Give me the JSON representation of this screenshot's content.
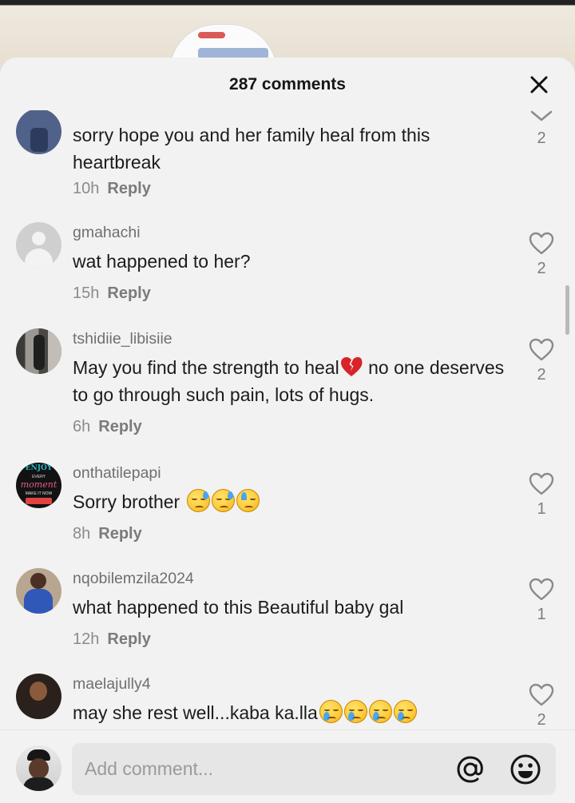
{
  "header": {
    "title": "287 comments"
  },
  "comments": [
    {
      "username": "",
      "text": "sorry hope you and her family heal from this heartbreak",
      "time": "10h",
      "reply": "Reply",
      "likes": "2",
      "icon": "chevron-down-icon"
    },
    {
      "username": "gmahachi",
      "text": "wat happened to her?",
      "time": "15h",
      "reply": "Reply",
      "likes": "2",
      "icon": "heart-outline-icon"
    },
    {
      "username": "tshidiie_libisiie",
      "text_before": "May you find the strength to heal",
      "text_after": " no one deserves to go through such pain, lots of hugs.",
      "time": "6h",
      "reply": "Reply",
      "likes": "2",
      "icon": "heart-outline-icon"
    },
    {
      "username": "onthatilepapi",
      "text": "Sorry brother ",
      "time": "8h",
      "reply": "Reply",
      "likes": "1",
      "icon": "heart-outline-icon",
      "avatar_text": [
        "ENJOY",
        "EVERY",
        "moment",
        "MAKE IT NOW"
      ]
    },
    {
      "username": "nqobilemzila2024",
      "text": "what happened to this Beautiful baby gal",
      "time": "12h",
      "reply": "Reply",
      "likes": "1",
      "icon": "heart-outline-icon"
    },
    {
      "username": "maelajully4",
      "text": "may she rest well...kaba ka.lla",
      "time": "",
      "reply": "",
      "likes": "2",
      "icon": "heart-outline-icon"
    }
  ],
  "composer": {
    "placeholder": "Add comment..."
  },
  "colors": {
    "sheet": "#f2f2f2",
    "text": "#1c1c1c",
    "muted": "#8b8b8b",
    "input": "#e6e6e6"
  }
}
